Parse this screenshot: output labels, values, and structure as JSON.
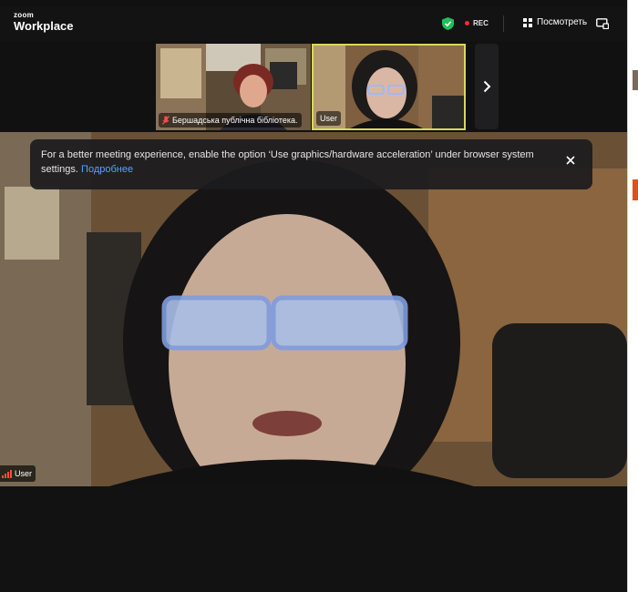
{
  "brand": {
    "small": "zoom",
    "big": "Workplace"
  },
  "topbar": {
    "rec_label": "REC",
    "view_label": "Посмотреть"
  },
  "thumbnails": [
    {
      "label": "Бершадська публічна бібліотека."
    },
    {
      "label": "User"
    }
  ],
  "notice": {
    "text": "For a better meeting experience, enable the option ‘Use graphics/hardware acceleration’ under browser system settings.",
    "link": "Подробнее"
  },
  "main_video": {
    "label": "User"
  },
  "colors": {
    "accent_active_border": "#d8d85a",
    "rec_dot": "#ff2a2a",
    "link": "#5aa1ff",
    "shield": "#1fbf5a"
  },
  "icons": [
    "shield-check-icon",
    "rec-dot-icon",
    "gallery-view-icon",
    "screen-share-icon",
    "mic-off-icon",
    "chevron-right-icon",
    "close-icon",
    "signal-bars-icon"
  ]
}
